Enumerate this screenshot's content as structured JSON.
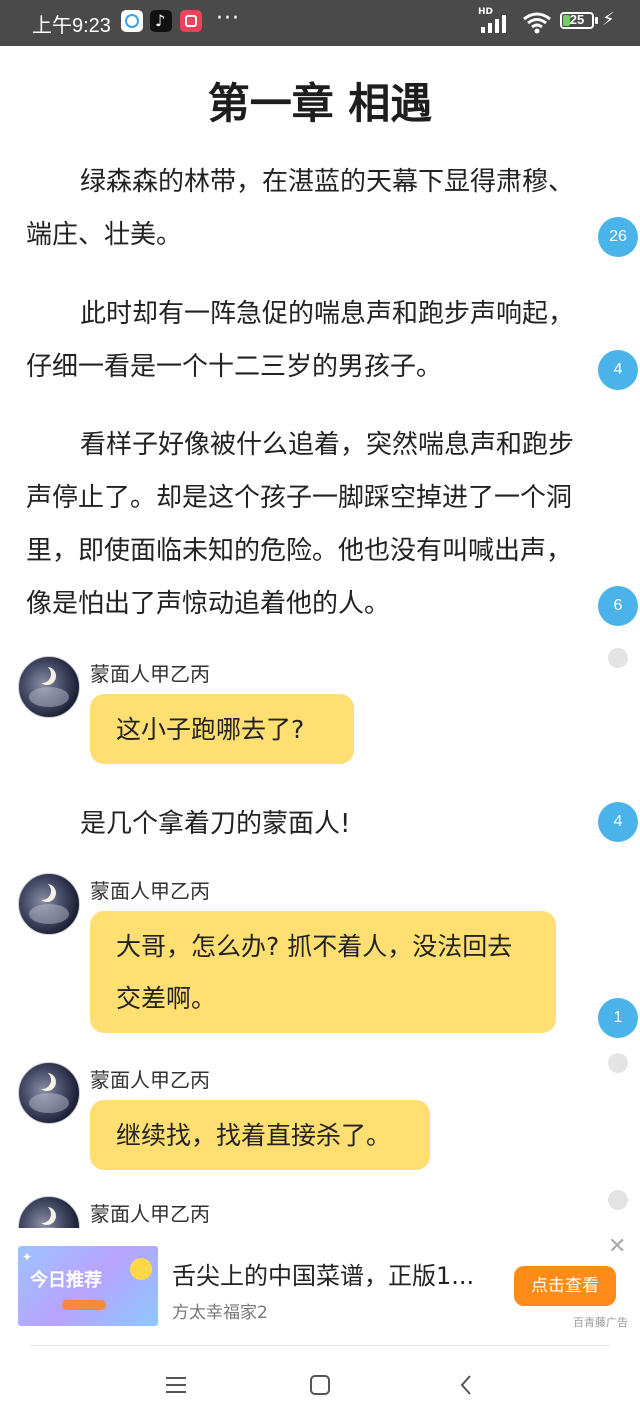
{
  "status_bar": {
    "time": "上午9:23",
    "battery_level": "25",
    "battery_fraction": 0.25,
    "network": "HD",
    "icons": [
      "baidu-netdisk-icon",
      "tiktok-icon",
      "kuaishou-icon",
      "more-dots-icon",
      "signal-icon",
      "wifi-icon",
      "battery-icon",
      "charging-icon"
    ]
  },
  "chapter": {
    "title": "第一章 相遇"
  },
  "paragraphs": [
    {
      "text": "绿森森的林带，在湛蓝的天幕下显得肃穆、端庄、壮美。",
      "comments": "26"
    },
    {
      "text": "此时却有一阵急促的喘息声和跑步声响起，仔细一看是一个十二三岁的男孩子。",
      "comments": "4"
    },
    {
      "text": "看样子好像被什么追着，突然喘息声和跑步声停止了。却是这个孩子一脚踩空掉进了一个洞里，即使面临未知的危险。他也没有叫喊出声，像是怕出了声惊动追着他的人。",
      "comments": "6"
    }
  ],
  "dialogues": [
    {
      "speaker": "蒙面人甲乙丙",
      "text": "这小子跑哪去了?"
    },
    {
      "speaker": "蒙面人甲乙丙",
      "text": "大哥，怎么办? 抓不着人，没法回去交差啊。",
      "comments": "1"
    },
    {
      "speaker": "蒙面人甲乙丙",
      "text": "继续找，找着直接杀了。"
    },
    {
      "speaker": "蒙面人甲乙丙",
      "text": ""
    }
  ],
  "narration_line": {
    "text": "是几个拿着刀的蒙面人!",
    "comments": "4"
  },
  "ad": {
    "title": "舌尖上的中国菜谱，正版1...",
    "subtitle": "方太幸福家2",
    "button_label": "点击查看",
    "source": "百青藤广告",
    "thumb_text": "今日推荐",
    "thumb_star": "✦"
  },
  "navbar": {
    "items": [
      "menu-icon",
      "home-icon",
      "back-icon"
    ]
  },
  "colors": {
    "status_bar": "#4a4a4a",
    "bubble": "#ffdf72",
    "badge": "#4ab3ea",
    "ad_button": "#ff8c1a"
  }
}
